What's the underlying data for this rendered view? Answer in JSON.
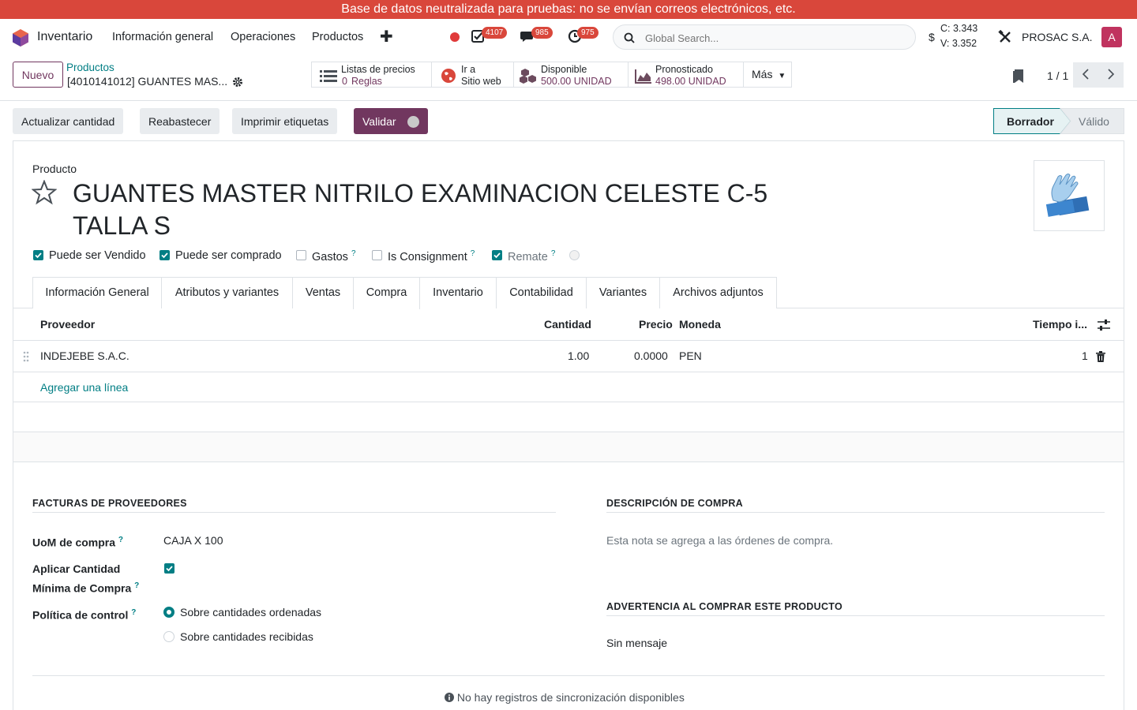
{
  "banner": "Base de datos neutralizada para pruebas: no se envían correos electrónicos, etc.",
  "navbar": {
    "app_name": "Inventario",
    "menu": [
      "Información general",
      "Operaciones",
      "Productos"
    ],
    "badges": {
      "activities": "4107",
      "messages": "985",
      "clock": "975"
    },
    "search_placeholder": "Global Search...",
    "currency_symbol": "$",
    "c_rate": "C: 3.343",
    "v_rate": "V: 3.352",
    "company": "PROSAC S.A.",
    "avatar_letter": "A"
  },
  "control": {
    "new_label": "Nuevo",
    "breadcrumb": "Productos",
    "record_name": "[4010141012] GUANTES MAS...",
    "smart_buttons": {
      "pricelists": {
        "line1": "Listas de precios",
        "value": "0",
        "unit": "Reglas"
      },
      "website": {
        "line1": "Ir a",
        "line2": "Sitio web"
      },
      "available": {
        "line1": "Disponible",
        "line2": "500.00 UNIDAD"
      },
      "forecast": {
        "line1": "Pronosticado",
        "line2": "498.00 UNIDAD"
      },
      "more": "Más"
    },
    "pager": "1 / 1"
  },
  "statusbar": {
    "buttons": [
      "Actualizar cantidad",
      "Reabastecer",
      "Imprimir etiquetas"
    ],
    "validate": "Validar",
    "stages": [
      "Borrador",
      "Válido"
    ]
  },
  "form": {
    "product_label": "Producto",
    "title": "GUANTES MASTER NITRILO EXAMINACION CELESTE C-5 TALLA S",
    "checks": [
      {
        "label": "Puede ser Vendido",
        "checked": true,
        "help": false
      },
      {
        "label": "Puede ser comprado",
        "checked": true,
        "help": false
      },
      {
        "label": "Gastos",
        "checked": false,
        "help": true
      },
      {
        "label": "Is Consignment",
        "checked": false,
        "help": true
      },
      {
        "label": "Remate",
        "checked": true,
        "help": true
      }
    ],
    "help_mark": "?",
    "tabs": [
      "Información General",
      "Atributos y variantes",
      "Ventas",
      "Compra",
      "Inventario",
      "Contabilidad",
      "Variantes",
      "Archivos adjuntos"
    ],
    "active_tab": "Compra",
    "table": {
      "headers": {
        "vendor": "Proveedor",
        "qty": "Cantidad",
        "price": "Precio",
        "currency": "Moneda",
        "lead": "Tiempo i..."
      },
      "rows": [
        {
          "vendor": "INDEJEBE S.A.C.",
          "qty": "1.00",
          "price": "0.0000",
          "currency": "PEN",
          "lead": "1"
        }
      ],
      "add_line": "Agregar una línea"
    },
    "vendor_bills": {
      "title": "FACTURAS DE PROVEEDORES",
      "uom_label": "UoM de compra",
      "uom_value": "CAJA X 100",
      "min_qty_label_1": "Aplicar Cantidad",
      "min_qty_label_2": "Mínima de Compra",
      "control_label": "Política de control",
      "control_options": [
        "Sobre cantidades ordenadas",
        "Sobre cantidades recibidas"
      ]
    },
    "purchase_description": {
      "title": "DESCRIPCIÓN DE COMPRA",
      "placeholder": "Esta nota se agrega a las órdenes de compra."
    },
    "purchase_warning": {
      "title": "ADVERTENCIA AL COMPRAR ESTE PRODUCTO",
      "value": "Sin mensaje"
    },
    "sync_message": "No hay registros de sincronización disponibles"
  },
  "colors": {
    "primary": "#71375f",
    "accent": "#017e84",
    "banner": "#d9473b"
  }
}
